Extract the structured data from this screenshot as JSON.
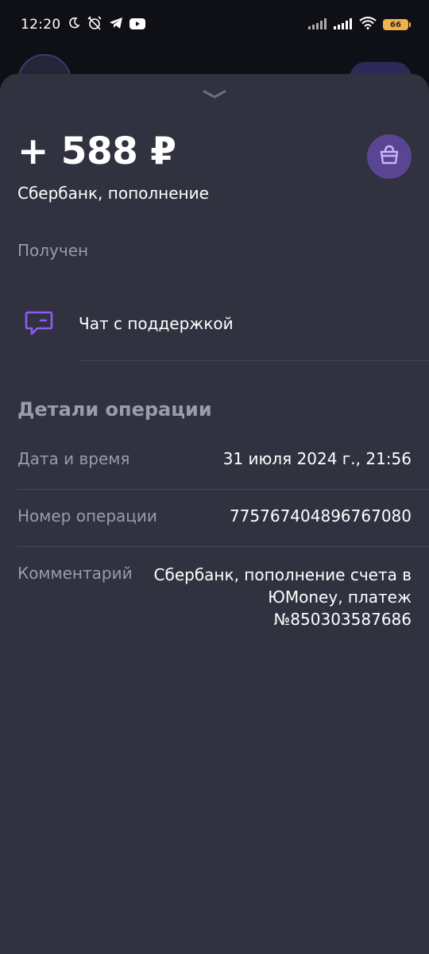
{
  "status_bar": {
    "time": "12:20",
    "battery": "66"
  },
  "transaction": {
    "amount": "+ 588 ₽",
    "subtitle": "Сбербанк, пополнение",
    "status": "Получен"
  },
  "support": {
    "label": "Чат с поддержкой"
  },
  "details": {
    "title": "Детали операции",
    "rows": [
      {
        "label": "Дата и время",
        "value": "31 июля 2024 г., 21:56"
      },
      {
        "label": "Номер операции",
        "value": "775767404896767080"
      },
      {
        "label": "Комментарий",
        "value": "Сбербанк, пополнение счета в ЮMoney, платеж №850303587686"
      }
    ]
  },
  "colors": {
    "sheet_bg": "#31323f",
    "accent": "#8b5cf6",
    "muted_text": "#9a9bab"
  }
}
